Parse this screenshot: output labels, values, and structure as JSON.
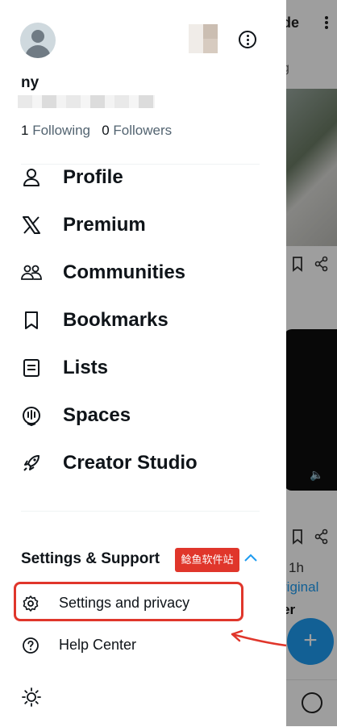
{
  "background": {
    "title_fragment": "de",
    "second_fragment": "g",
    "time_fragment": "1h",
    "link_fragment": "riginal",
    "text_fragment": "er",
    "fab_label": "+"
  },
  "profile": {
    "username": "ny",
    "following_count": "1",
    "following_label": "Following",
    "followers_count": "0",
    "followers_label": "Followers"
  },
  "nav": [
    {
      "label": "Profile",
      "icon": "person-icon"
    },
    {
      "label": "Premium",
      "icon": "x-logo-icon"
    },
    {
      "label": "Communities",
      "icon": "communities-icon"
    },
    {
      "label": "Bookmarks",
      "icon": "bookmark-icon"
    },
    {
      "label": "Lists",
      "icon": "list-icon"
    },
    {
      "label": "Spaces",
      "icon": "spaces-icon"
    },
    {
      "label": "Creator Studio",
      "icon": "rocket-icon"
    }
  ],
  "settings_section": {
    "title": "Settings & Support",
    "watermark": "鲶鱼软件站",
    "items": [
      {
        "label": "Settings and privacy",
        "icon": "gear-icon"
      },
      {
        "label": "Help Center",
        "icon": "help-icon"
      }
    ]
  },
  "colors": {
    "accent": "#1d9bf0",
    "highlight": "#e0362b",
    "text": "#0f1419",
    "muted": "#536471"
  }
}
